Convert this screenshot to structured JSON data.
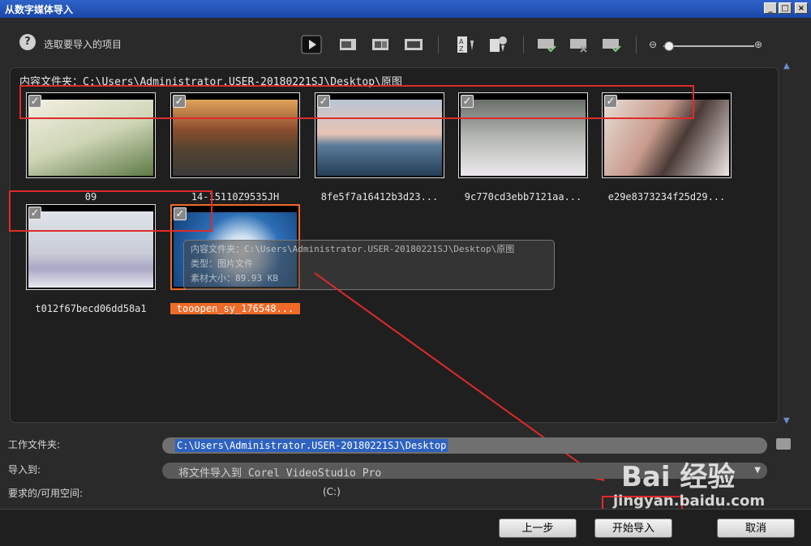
{
  "window": {
    "title": "从数字媒体导入",
    "min": "_",
    "max": "□",
    "close": "×"
  },
  "header": {
    "help_icon": "?",
    "help_label": "选取要导入的项目"
  },
  "toolbar": {
    "icons": [
      "play-icon",
      "clip-view-icon",
      "scene-view-icon",
      "timeline-view-icon",
      "sort-az-icon",
      "sort-time-icon",
      "select-all-icon",
      "deselect-all-icon",
      "invert-select-icon"
    ],
    "zoom_level": 0.0
  },
  "content": {
    "folder_path": "内容文件夹：C:\\Users\\Administrator.USER-20180221SJ\\Desktop\\原图",
    "items": [
      {
        "label": "09",
        "checked": true
      },
      {
        "label": "14-15110Z9535JH",
        "checked": true
      },
      {
        "label": "8fe5f7a16412b3d23...",
        "checked": true
      },
      {
        "label": "9c770cd3ebb7121aa...",
        "checked": true
      },
      {
        "label": "e29e8373234f25d29...",
        "checked": true
      },
      {
        "label": "t012f67becd06dd58a1",
        "checked": true
      },
      {
        "label": "tooopen_sy_176548...",
        "checked": true,
        "selected": true
      }
    ],
    "tooltip": {
      "line1": "内容文件夹：C:\\Users\\Administrator.USER-20180221SJ\\Desktop\\原图",
      "line2": "类型：图片文件",
      "line3": "素材大小：89.93 KB"
    }
  },
  "form": {
    "work_folder_label": "工作文件夹:",
    "work_folder_value": "C:\\Users\\Administrator.USER-20180221SJ\\Desktop",
    "import_to_label": "导入到:",
    "import_to_value": "将文件导入到 Corel VideoStudio Pro",
    "space_label": "要求的/可用空间:",
    "space_value": "(C:)"
  },
  "buttons": {
    "back": "上一步",
    "start": "开始导入",
    "cancel": "取消"
  },
  "watermark": {
    "line1": "Bai 经验",
    "line2": "jingyan.baidu.com"
  },
  "colors": {
    "accent": "#f06a28",
    "annotation": "#e02a2a",
    "selection": "#2e62c0"
  }
}
